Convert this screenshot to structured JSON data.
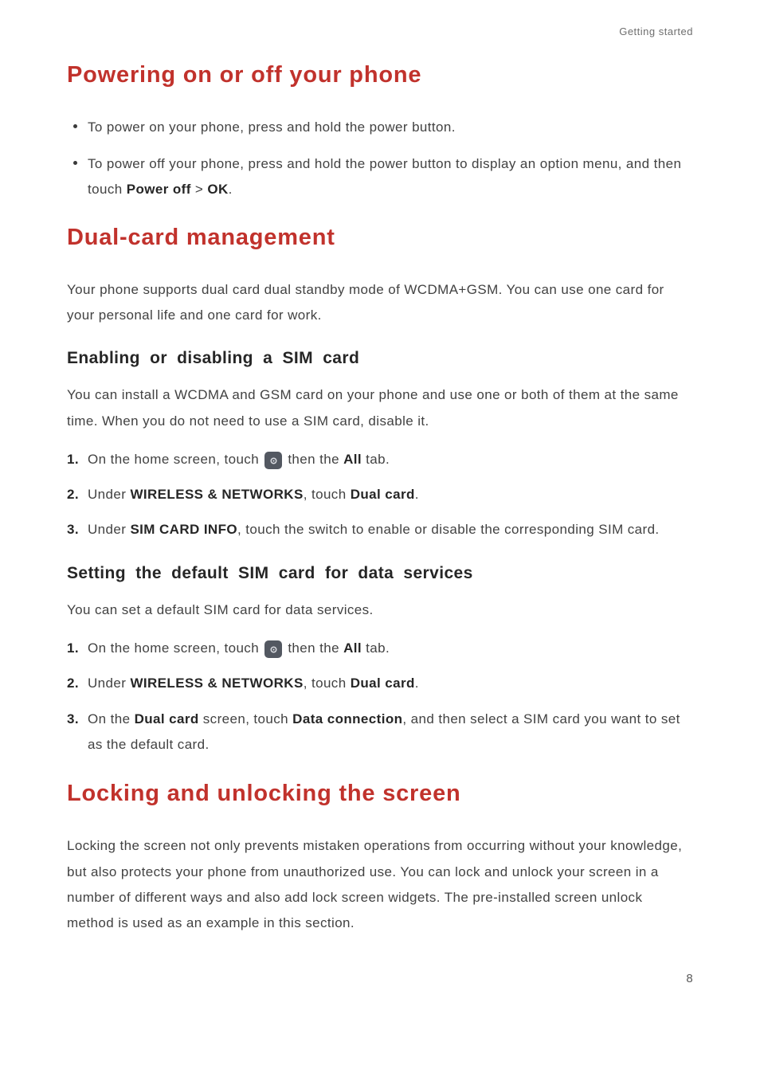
{
  "header_chapter": "Getting started",
  "page_number": "8",
  "sections": {
    "power": {
      "title": "Powering on or off your phone",
      "bullets": [
        {
          "pre": "To power on your phone, press and hold the power button."
        },
        {
          "pre": "To power off your phone, press and hold the power button to display an option menu, and then touch ",
          "b1": "Power off",
          "mid": " > ",
          "b2": "OK",
          "post": "."
        }
      ]
    },
    "dual": {
      "title": "Dual-card management",
      "intro": "Your phone supports dual card dual standby mode of WCDMA+GSM. You can use one card for your personal life and one card for work.",
      "enable": {
        "heading": "Enabling or disabling a SIM card",
        "text": "You can install a WCDMA and GSM card on your phone and use one or both of them at the same time. When you do not need to use a SIM card, disable it.",
        "steps": {
          "s1_pre": "On the home screen, touch ",
          "s1_mid": " then the ",
          "s1_b": "All",
          "s1_post": " tab.",
          "s2_pre": "Under ",
          "s2_b1": "WIRELESS & NETWORKS",
          "s2_mid": ", touch ",
          "s2_b2": "Dual card",
          "s2_post": ".",
          "s3_pre": "Under ",
          "s3_b": "SIM CARD INFO",
          "s3_post": ", touch the switch to enable or disable the corresponding SIM card."
        }
      },
      "default": {
        "heading": "Setting the default SIM card for data services",
        "text": "You can set a default SIM card for data services.",
        "steps": {
          "s1_pre": "On the home screen, touch ",
          "s1_mid": " then the ",
          "s1_b": "All",
          "s1_post": " tab.",
          "s2_pre": "Under ",
          "s2_b1": "WIRELESS & NETWORKS",
          "s2_mid": ", touch ",
          "s2_b2": "Dual card",
          "s2_post": ".",
          "s3_pre": "On the ",
          "s3_b1": "Dual card",
          "s3_mid": " screen, touch ",
          "s3_b2": "Data connection",
          "s3_post": ", and then select a SIM card you want to set as the default card."
        }
      }
    },
    "lock": {
      "title": "Locking and unlocking the screen",
      "text": "Locking the screen not only prevents mistaken operations from occurring without your knowledge, but also protects your phone from unauthorized use. You can lock and unlock your screen in a number of different ways and also add lock screen widgets. The pre-installed screen unlock method is used as an example in this section."
    }
  },
  "icons": {
    "settings": "settings-icon"
  }
}
